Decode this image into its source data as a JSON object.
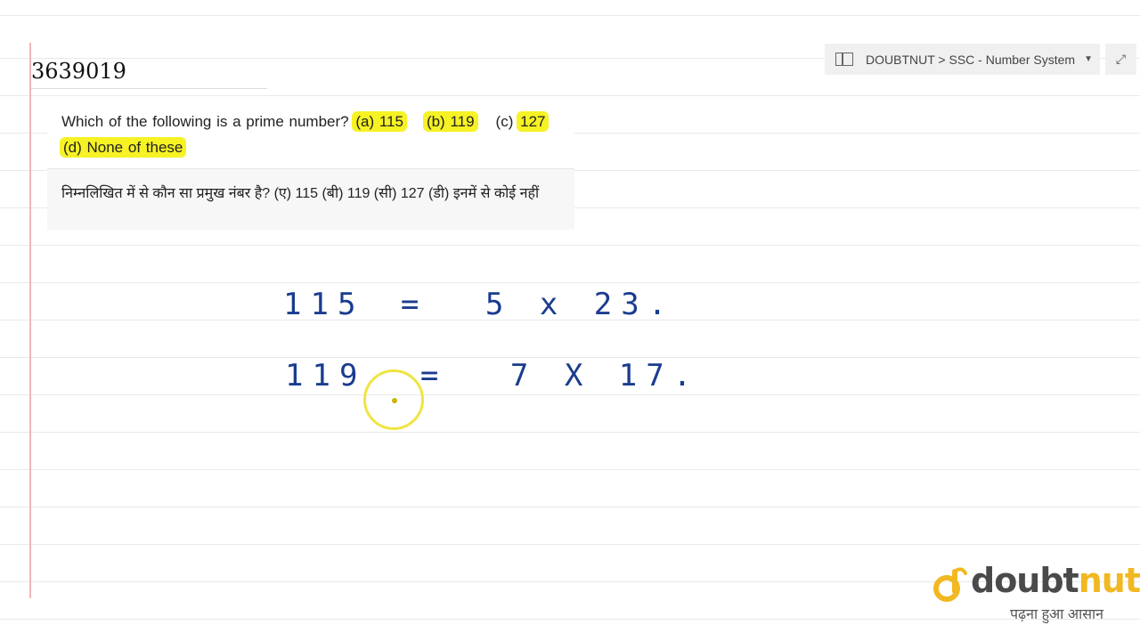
{
  "video_id": "3639019",
  "breadcrumb": {
    "text": "DOUBTNUT > SSC - Number System"
  },
  "expand_icon": "⤢",
  "question": {
    "lead": "Which of the following is a prime number?",
    "opt_a": "(a) 115",
    "opt_b": "(b) 119",
    "opt_c": "(c)",
    "opt_c_value": "127",
    "opt_d": "(d) None of these"
  },
  "hindi_question": "निम्नलिखित में से कौन सा प्रमुख नंबर है? (ए) 115 (बी) 119 (सी) 127 (डी) इनमें से कोई नहीं",
  "handwriting": {
    "line1": {
      "left": "115",
      "eq": "=",
      "right": "5 x 23",
      "dot": "."
    },
    "line2": {
      "left": "119",
      "eq": "=",
      "right": "7 X 17",
      "dot": "."
    }
  },
  "logo": {
    "word_dark": "doubt",
    "word_accent": "nut",
    "tagline": "पढ़ना हुआ आसान",
    "colors": {
      "accent": "#f2b821",
      "dark": "#4a4a4a",
      "highlight": "#f6f224",
      "ink": "#1a3c8f"
    }
  }
}
